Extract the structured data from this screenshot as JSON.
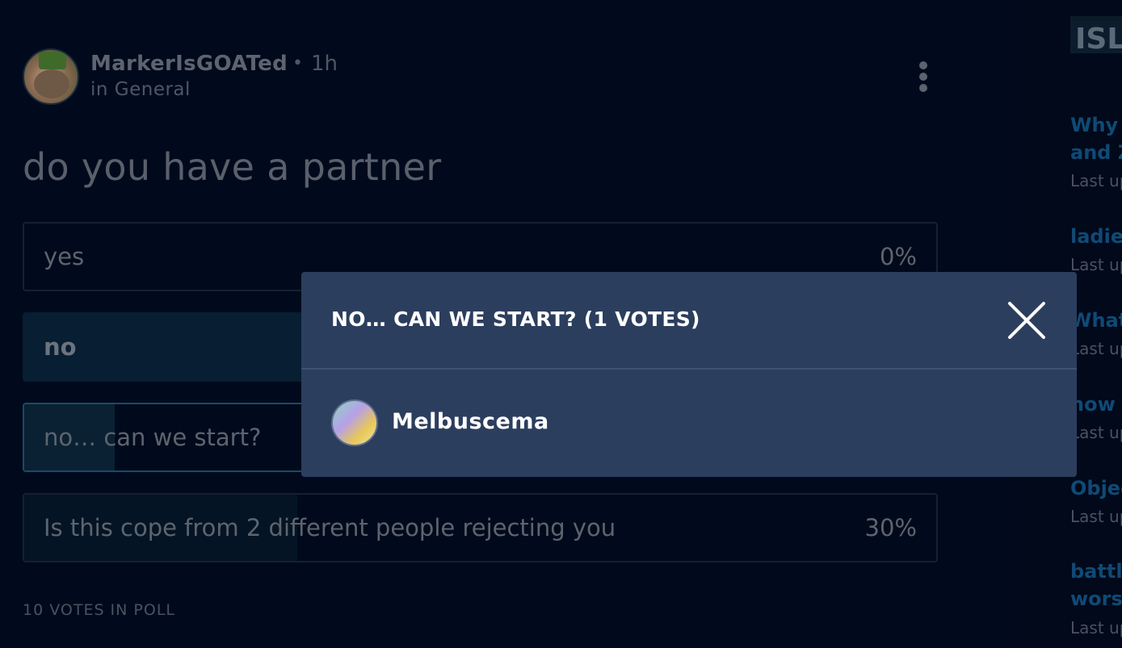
{
  "post": {
    "author": "MarkerIsGOATed",
    "separator": "•",
    "time": "1h",
    "community": "in General",
    "question": "do you have a partner",
    "options": [
      {
        "label": "yes",
        "percent": "0%"
      },
      {
        "label": "no",
        "percent": ""
      },
      {
        "label": "no… can we start?",
        "percent": ""
      },
      {
        "label": "Is this cope from 2 different people rejecting you",
        "percent": "30%"
      }
    ],
    "total_votes": "10 VOTES IN POLL"
  },
  "sidebar": {
    "title": "ISL",
    "threads": [
      {
        "title_lines": [
          "Why i",
          "and Z"
        ],
        "meta": "Last up"
      },
      {
        "title_lines": [
          "ladies"
        ],
        "meta": "Last up"
      },
      {
        "title_lines": [
          "What"
        ],
        "meta": "Last up"
      },
      {
        "title_lines": [
          "how c"
        ],
        "meta": "Last up"
      },
      {
        "title_lines": [
          "Objec"
        ],
        "meta": "Last up"
      },
      {
        "title_lines": [
          "battle",
          "worst"
        ],
        "meta": "Last up"
      }
    ]
  },
  "modal": {
    "title": "NO… CAN WE START? (1 VOTES)",
    "voters": [
      {
        "name": "Melbuscema"
      }
    ]
  }
}
